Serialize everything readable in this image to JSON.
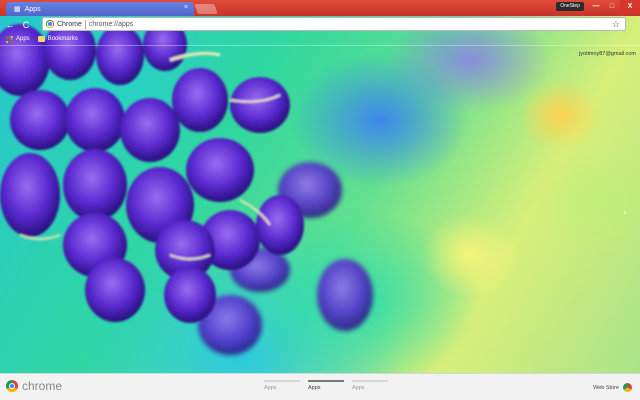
{
  "window": {
    "tab_title": "Apps",
    "profile_label": "OneStep",
    "minimize_glyph": "—",
    "maximize_glyph": "□",
    "close_glyph": "X"
  },
  "toolbar": {
    "back_glyph": "←",
    "reload_glyph": "C",
    "omnibox_chip": "Chrome",
    "omnibox_url": "chrome://apps",
    "star_glyph": "☆"
  },
  "bookmarks": {
    "items": [
      {
        "label": "Apps",
        "icon": "apps-grid-icon"
      },
      {
        "label": "Bookmarks",
        "icon": "folder-icon"
      }
    ]
  },
  "account": {
    "email": "jyotimoy87@gmail.com"
  },
  "launcher": {
    "brand": "chrome",
    "next_glyph": "›",
    "pages": [
      {
        "label": "Apps",
        "active": false
      },
      {
        "label": "Apps",
        "active": true
      },
      {
        "label": "Apps",
        "active": false
      }
    ],
    "webstore_label": "Web Store"
  },
  "colors": {
    "frame": "#c8332a",
    "tab": "#4a7fe6",
    "bottom_bar": "#f2f2f2"
  }
}
